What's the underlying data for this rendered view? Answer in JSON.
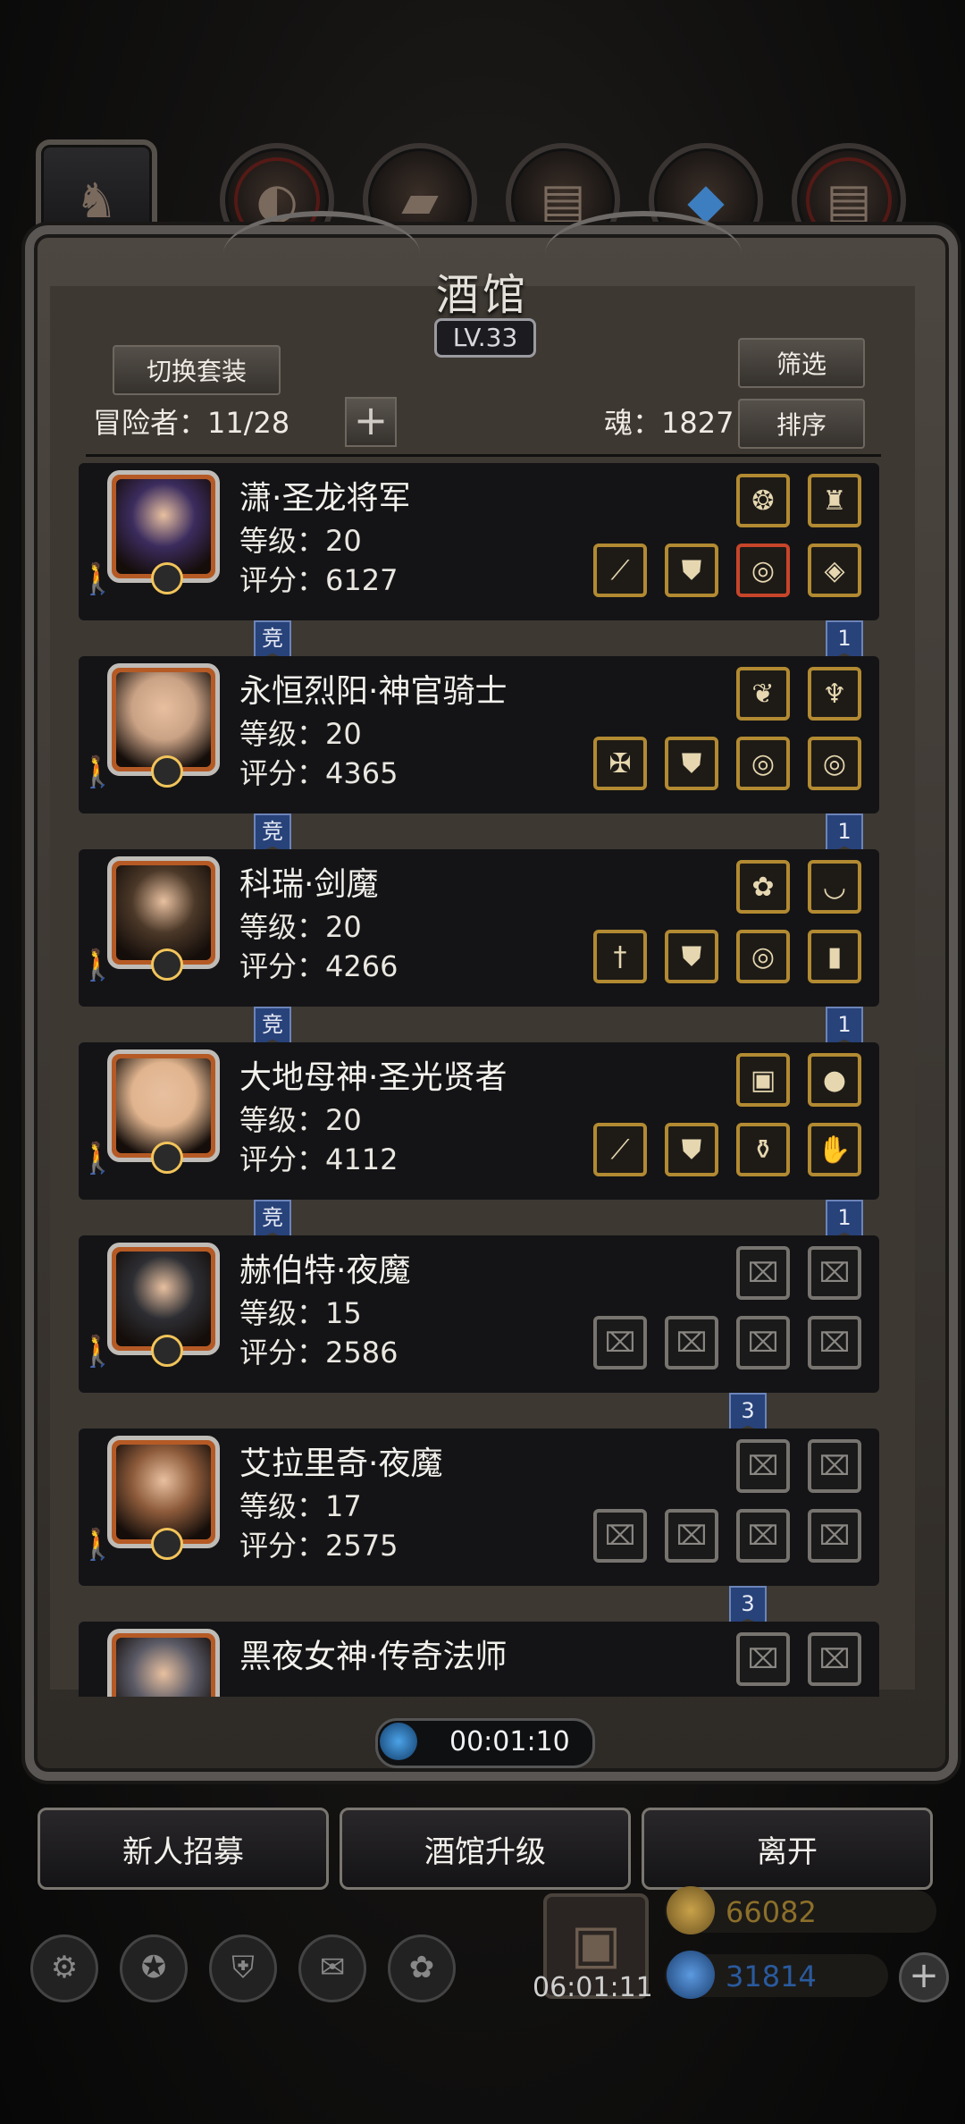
{
  "header": {
    "title": "酒馆",
    "level": "LV.33",
    "switch_outfit": "切换套装",
    "filter": "筛选",
    "sort": "排序",
    "adventurers_label": "冒险者：11/28",
    "souls_label": "魂：1827"
  },
  "heroes": [
    {
      "name": "潇·圣龙将军",
      "level": "等级：20",
      "score": "评分：6127",
      "badge_left": "竞",
      "badge_right": "1",
      "slots": [
        "amulet-icon",
        "lantern-icon",
        "spear-icon",
        "armor-icon",
        "ring-icon",
        "gem-icon"
      ],
      "portrait": "#3b2c5e"
    },
    {
      "name": "永恒烈阳·神官骑士",
      "level": "等级：20",
      "score": "评分：4365",
      "badge_left": "竞",
      "badge_right": "1",
      "slots": [
        "wings-icon",
        "chalice-icon",
        "mace-icon",
        "armor-icon",
        "ring-icon",
        "ring-icon"
      ],
      "portrait": "#c9a184"
    },
    {
      "name": "科瑞·剑魔",
      "level": "等级：20",
      "score": "评分：4266",
      "badge_left": "竞",
      "badge_right": "1",
      "slots": [
        "flower-icon",
        "bowl-icon",
        "sword-icon",
        "armor-icon",
        "ring-icon",
        "scroll-icon"
      ],
      "portrait": "#4b3828"
    },
    {
      "name": "大地母神·圣光贤者",
      "level": "等级：20",
      "score": "评分：4112",
      "badge_left": "竞",
      "badge_right": "1",
      "slots": [
        "book-icon",
        "stone-icon",
        "staff-icon",
        "armor-icon",
        "potion-icon",
        "glove-icon"
      ],
      "portrait": "#e0b48e"
    },
    {
      "name": "赫伯特·夜魔",
      "level": "等级：15",
      "score": "评分：2586",
      "badge_left": "",
      "badge_right": "3",
      "slots": [
        "empty",
        "empty",
        "empty",
        "empty",
        "empty",
        "empty"
      ],
      "portrait": "#2d2e33"
    },
    {
      "name": "艾拉里奇·夜魔",
      "level": "等级：17",
      "score": "评分：2575",
      "badge_left": "",
      "badge_right": "3",
      "slots": [
        "empty",
        "empty",
        "empty",
        "empty",
        "empty",
        "empty"
      ],
      "portrait": "#8c5a3a"
    },
    {
      "name": "黑夜女神·传奇法师",
      "level": "",
      "score": "",
      "badge_left": "",
      "badge_right": "",
      "slots": [
        "empty",
        "empty"
      ],
      "portrait": "#5a5a66"
    }
  ],
  "timer": "00:01:10",
  "bottom_buttons": {
    "recruit": "新人招募",
    "upgrade": "酒馆升级",
    "leave": "离开"
  },
  "gift_timer": "06:01:11",
  "resources": {
    "gold": "66082",
    "gems": "31814"
  },
  "colors": {
    "gold_text": "#8c6f2a",
    "gem_text": "#2a5a9e",
    "slot_gold": "#b28a32"
  }
}
